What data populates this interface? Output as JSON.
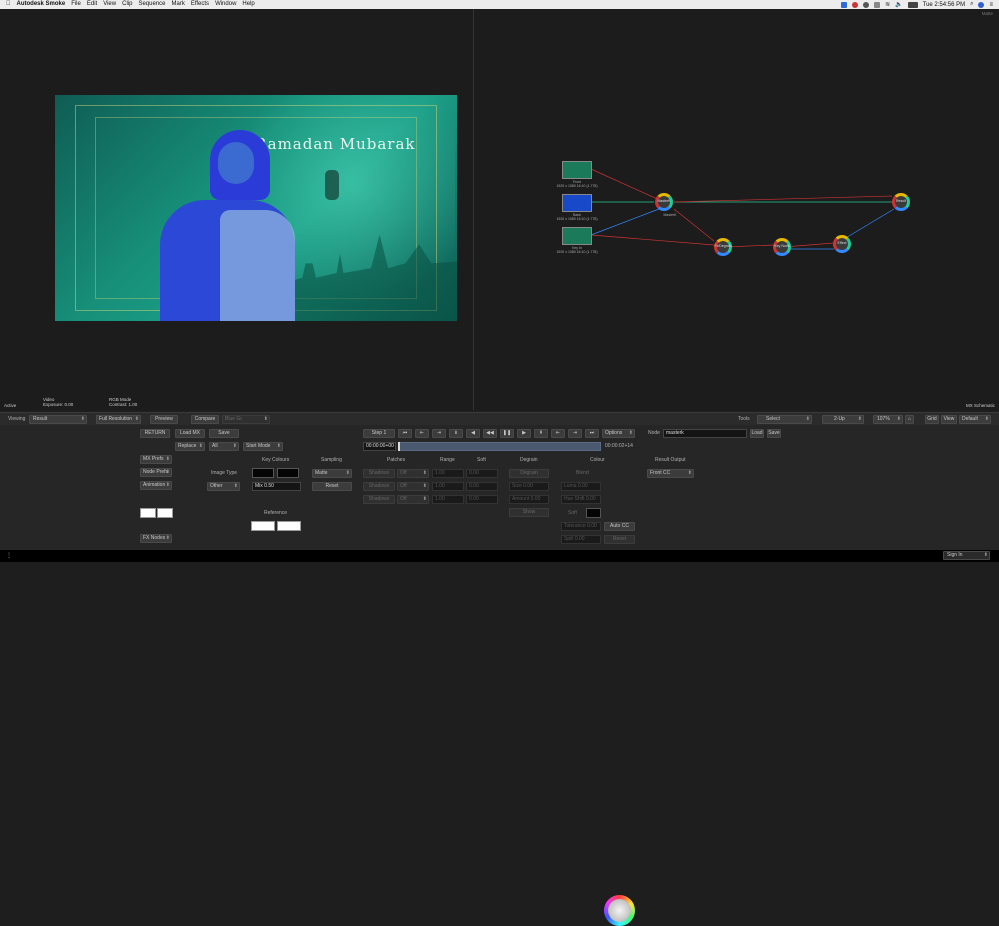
{
  "menubar": {
    "app_name": "Autodesk Smoke",
    "items": [
      "File",
      "Edit",
      "View",
      "Clip",
      "Sequence",
      "Mark",
      "Effects",
      "Window",
      "Help"
    ],
    "clock": "Tue 2:54:56 PM"
  },
  "viewer": {
    "frame_title": "Ramadan Mubarak",
    "bottom_left": "Active",
    "info_video_label": "Video",
    "info_exposure": "Exposure: 0.00",
    "info_mode": "RGB Mode",
    "info_contrast": "Contrast: 1.00"
  },
  "schematic": {
    "corner_label": "MX Schematic",
    "top_right": "Matte",
    "inputs": [
      {
        "caption": "Front",
        "sub": "1920 x 1080 16:10 (1.778)"
      },
      {
        "caption": "Back",
        "sub": "1920 x 1080 16:10 (1.778)"
      },
      {
        "caption": "Key In",
        "sub": "1920 x 1080 16:10 (1.778)"
      }
    ],
    "nodes": {
      "masterk": "MasterK",
      "masterk_sub": "MasterK",
      "result": "Result",
      "node1": "Fx/Degrain",
      "node2": "Key Node",
      "node3": "Effect"
    }
  },
  "toolbar": {
    "viewing_label": "Viewing",
    "viewing_value": "Result",
    "resolution_value": "Full Resolution",
    "preview": "Preview",
    "compare": "Compare",
    "compare_value": "Blue Gr.",
    "tools_label": "Tools",
    "select_value": "Select",
    "layout_value": "2-Up",
    "zoom_value": "107%",
    "grid": "Grid",
    "view": "View",
    "view_value": "Default"
  },
  "panel": {
    "return": "RETURN",
    "load_mx": "Load MX",
    "save": "Save",
    "replace": "Replace",
    "all": "All",
    "start_mode": "Start Mode",
    "mx_prefs": "MX Prefs",
    "node_prefs": "Node Prefs",
    "animation": "Animation",
    "fx_nodes": "FX Nodes",
    "key_colours": "Key Colours",
    "image_type": "Image Type",
    "other": "Other",
    "mix": "Mix 0.50",
    "reference": "Reference",
    "sampling": "Sampling",
    "matte": "Matte",
    "reset": "Reset",
    "step": "Step 1",
    "options": "Options",
    "timecode_start": "00:00:00+00",
    "timecode_end": "00:00:02+14",
    "patches": "Patches",
    "range": "Range",
    "soft": "Soft",
    "degrain": "Degrain",
    "colour": "Colour",
    "blend": "Blend",
    "result_output": "Result Output",
    "front_cc": "Front CC",
    "node_label": "Node",
    "node_value": "masterk",
    "load": "Load",
    "save2": "Save",
    "auto_cc": "Auto CC",
    "patch_rows": [
      "Shadows",
      "Shadows",
      "Shadows"
    ],
    "patch_vals": [
      "Off",
      "Off",
      "Off"
    ],
    "range_vals": [
      "1.00",
      "1.00",
      "1.00"
    ],
    "soft_vals": [
      "0.00",
      "0.00",
      "0.00"
    ],
    "degrain_top": "Degrain",
    "size": "Size 0.00",
    "amount": "Amount 0.00",
    "show": "Show",
    "luma": "Luma 0.00",
    "hue_shift": "Hue Shift 0.00",
    "soft_label": "Soft",
    "tolerance": "Tolerance 0.00",
    "spill": "Spill 0.00",
    "reset2": "Reset"
  },
  "statusbar": {
    "sign_in": "Sign In"
  }
}
